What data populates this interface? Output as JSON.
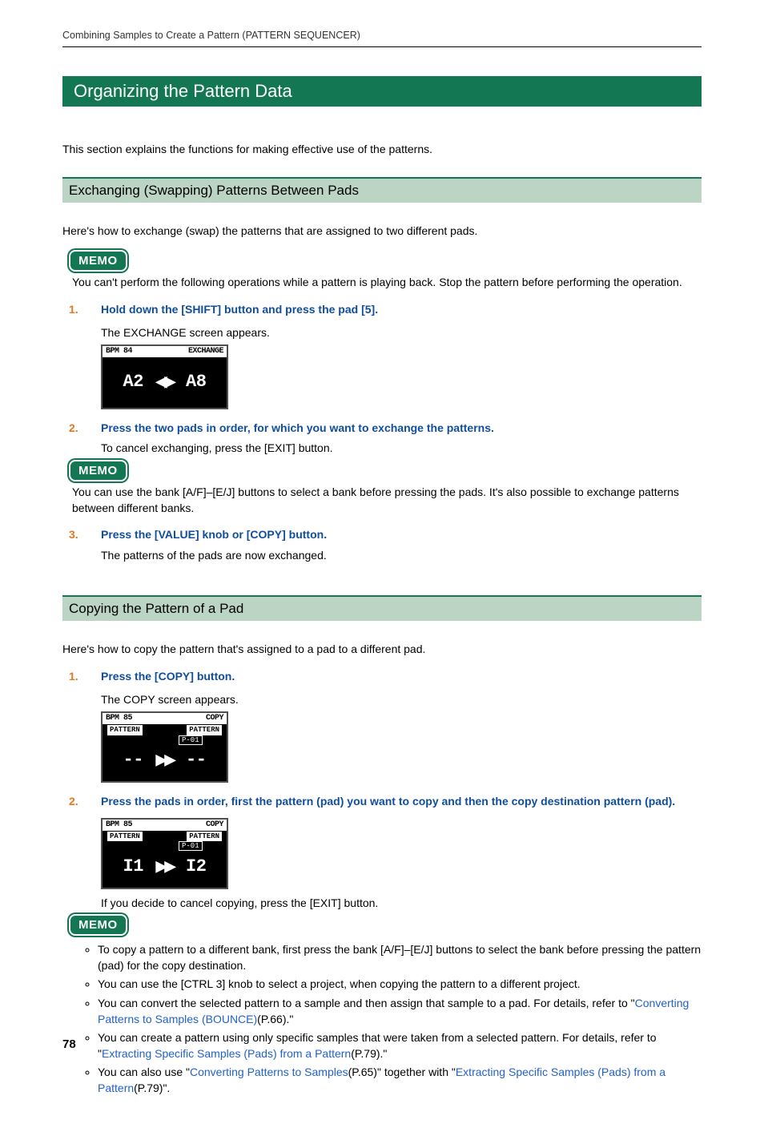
{
  "page": {
    "header": "Combining Samples to Create a Pattern (PATTERN SEQUENCER)",
    "number": "78"
  },
  "h1": "Organizing the Pattern Data",
  "intro": "This section explains the functions for making effective use of the patterns.",
  "section1": {
    "title": "Exchanging (Swapping) Patterns Between Pads",
    "lead": "Here's how to exchange (swap) the patterns that are assigned to two different pads.",
    "memo_label": "MEMO",
    "memo_top": "You can't perform the following operations while a pattern is playing back. Stop the pattern before performing the operation.",
    "steps": {
      "n1": "1.",
      "s1": "Hold down the [SHIFT] button and press the pad [5].",
      "s1_body": "The EXCHANGE screen appears.",
      "lcd1": {
        "bpm": "BPM 84",
        "mode": "EXCHANGE",
        "main_l": "A2",
        "main_r": "A8"
      },
      "n2": "2.",
      "s2": "Press the two pads in order, for which you want to exchange the patterns.",
      "s2_body": "To cancel exchanging, press the [EXIT] button.",
      "memo2": "You can use the bank [A/F]–[E/J] buttons to select a bank before pressing the pads. It's also possible to exchange patterns between different banks.",
      "n3": "3.",
      "s3": "Press the [VALUE] knob or [COPY] button.",
      "s3_body": "The patterns of the pads are now exchanged."
    }
  },
  "section2": {
    "title": "Copying the Pattern of a Pad",
    "lead": "Here's how to copy the pattern that's assigned to a pad to a different pad.",
    "memo_label": "MEMO",
    "steps": {
      "n1": "1.",
      "s1": "Press the [COPY] button.",
      "s1_body": "The COPY screen appears.",
      "lcd1": {
        "bpm": "BPM 85",
        "mode": "COPY",
        "tag_l": "PATTERN",
        "tag_r": "PATTERN",
        "sub": "P-01",
        "main_l": "--",
        "main_r": "--"
      },
      "n2": "2.",
      "s2": "Press the pads in order, first the pattern (pad) you want to copy and then the copy destination pattern (pad).",
      "lcd2": {
        "bpm": "BPM 85",
        "mode": "COPY",
        "tag_l": "PATTERN",
        "tag_r": "PATTERN",
        "sub": "P-01",
        "main_l": "I1",
        "main_r": "I2"
      },
      "s2_body": "If you decide to cancel copying, press the [EXIT] button."
    },
    "memo_list": {
      "i1": "To copy a pattern to a different bank, first press the bank [A/F]–[E/J] buttons to select the bank before pressing the pattern (pad) for the copy destination.",
      "i2": "You can use the [CTRL 3] knob to select a project, when copying the pattern to a different project.",
      "i3_a": "You can convert the selected pattern to a sample and then assign that sample to a pad. For details, refer to \"",
      "i3_link": "Converting Patterns to Samples (BOUNCE)",
      "i3_b": "(P.66).\"",
      "i4_a": "You can create a pattern using only specific samples that were taken from a selected pattern. For details, refer to \"",
      "i4_link": "Extracting Specific Samples (Pads) from a Pattern",
      "i4_b": "(P.79).\"",
      "i5_a": "You can also use \"",
      "i5_link1": "Converting Patterns to Samples",
      "i5_mid": "(P.65)\" together with \"",
      "i5_link2": "Extracting Specific Samples (Pads) from a Pattern",
      "i5_b": "(P.79)\"."
    }
  }
}
